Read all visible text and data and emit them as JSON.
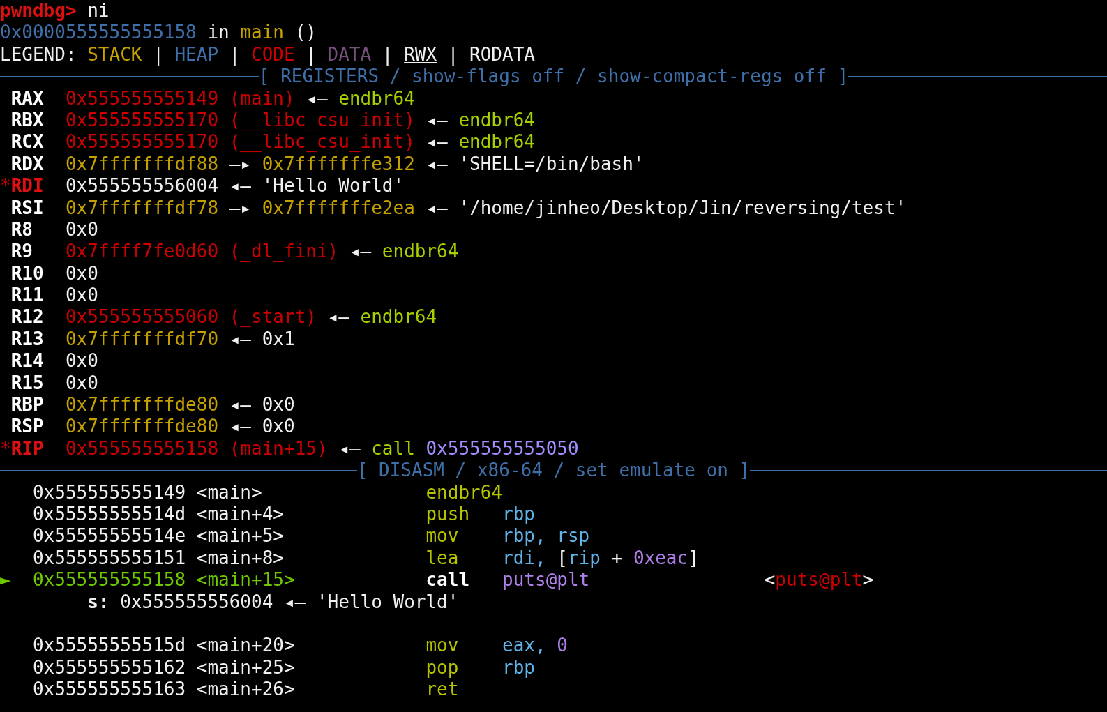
{
  "header_lines": [
    [
      {
        "text": "pwndbg>",
        "kind": "prompt"
      },
      {
        "text": "ni",
        "kind": "plain"
      }
    ],
    [
      {
        "text": "0x0000555555555158",
        "kind": "heap"
      },
      {
        "text": "in",
        "kind": "plain"
      },
      {
        "text": "main",
        "kind": "stack"
      },
      {
        "text": "()",
        "kind": "plain"
      }
    ],
    [
      {
        "text": "LEGEND:",
        "kind": "plain"
      },
      {
        "text": "STACK",
        "kind": "stack"
      },
      {
        "text": "|",
        "kind": "plain"
      },
      {
        "text": "HEAP",
        "kind": "heap"
      },
      {
        "text": "|",
        "kind": "plain"
      },
      {
        "text": "CODE",
        "kind": "code"
      },
      {
        "text": "|",
        "kind": "plain"
      },
      {
        "text": "DATA",
        "kind": "data"
      },
      {
        "text": "|",
        "kind": "plain"
      },
      {
        "text": "RWX",
        "kind": "rwx"
      },
      {
        "text": "|",
        "kind": "plain"
      },
      {
        "text": "RODATA",
        "kind": "plain"
      }
    ]
  ],
  "registers": {
    "title": "[ REGISTERS / show-flags off / show-compact-regs off ]",
    "rows": [
      {
        "name": "RAX",
        "changed": false,
        "values": [
          {
            "text": "0x555555555149 (main)",
            "kind": "code"
          },
          {
            "text": "◂—",
            "kind": "plain"
          },
          {
            "text": "endbr64",
            "kind": "instr"
          }
        ]
      },
      {
        "name": "RBX",
        "changed": false,
        "values": [
          {
            "text": "0x555555555170 (__libc_csu_init)",
            "kind": "code"
          },
          {
            "text": "◂—",
            "kind": "plain"
          },
          {
            "text": "endbr64",
            "kind": "instr"
          }
        ]
      },
      {
        "name": "RCX",
        "changed": false,
        "values": [
          {
            "text": "0x555555555170 (__libc_csu_init)",
            "kind": "code"
          },
          {
            "text": "◂—",
            "kind": "plain"
          },
          {
            "text": "endbr64",
            "kind": "instr"
          }
        ]
      },
      {
        "name": "RDX",
        "changed": false,
        "values": [
          {
            "text": "0x7fffffffdf88",
            "kind": "stack"
          },
          {
            "text": "—▸",
            "kind": "plain"
          },
          {
            "text": "0x7fffffffe312",
            "kind": "stack"
          },
          {
            "text": "◂—",
            "kind": "plain"
          },
          {
            "text": "'SHELL=/bin/bash'",
            "kind": "plain"
          }
        ]
      },
      {
        "marker": "*",
        "name": "RDI",
        "changed": true,
        "values": [
          {
            "text": "0x555555556004",
            "kind": "plain"
          },
          {
            "text": "◂—",
            "kind": "plain"
          },
          {
            "text": "'Hello World'",
            "kind": "plain"
          }
        ]
      },
      {
        "name": "RSI",
        "changed": false,
        "values": [
          {
            "text": "0x7fffffffdf78",
            "kind": "stack"
          },
          {
            "text": "—▸",
            "kind": "plain"
          },
          {
            "text": "0x7fffffffe2ea",
            "kind": "stack"
          },
          {
            "text": "◂—",
            "kind": "plain"
          },
          {
            "text": "'/home/jinheo/Desktop/Jin/reversing/test'",
            "kind": "plain"
          }
        ]
      },
      {
        "name": "R8",
        "changed": false,
        "values": [
          {
            "text": "0x0",
            "kind": "plain"
          }
        ]
      },
      {
        "name": "R9",
        "changed": false,
        "values": [
          {
            "text": "0x7ffff7fe0d60 (_dl_fini)",
            "kind": "code"
          },
          {
            "text": "◂—",
            "kind": "plain"
          },
          {
            "text": "endbr64",
            "kind": "instr"
          }
        ]
      },
      {
        "name": "R10",
        "changed": false,
        "values": [
          {
            "text": "0x0",
            "kind": "plain"
          }
        ]
      },
      {
        "name": "R11",
        "changed": false,
        "values": [
          {
            "text": "0x0",
            "kind": "plain"
          }
        ]
      },
      {
        "name": "R12",
        "changed": false,
        "values": [
          {
            "text": "0x555555555060 (_start)",
            "kind": "code"
          },
          {
            "text": "◂—",
            "kind": "plain"
          },
          {
            "text": "endbr64",
            "kind": "instr"
          }
        ]
      },
      {
        "name": "R13",
        "changed": false,
        "values": [
          {
            "text": "0x7fffffffdf70",
            "kind": "stack"
          },
          {
            "text": "◂—",
            "kind": "plain"
          },
          {
            "text": "0x1",
            "kind": "plain"
          }
        ]
      },
      {
        "name": "R14",
        "changed": false,
        "values": [
          {
            "text": "0x0",
            "kind": "plain"
          }
        ]
      },
      {
        "name": "R15",
        "changed": false,
        "values": [
          {
            "text": "0x0",
            "kind": "plain"
          }
        ]
      },
      {
        "name": "RBP",
        "changed": false,
        "values": [
          {
            "text": "0x7fffffffde80",
            "kind": "stack"
          },
          {
            "text": "◂—",
            "kind": "plain"
          },
          {
            "text": "0x0",
            "kind": "plain"
          }
        ]
      },
      {
        "name": "RSP",
        "changed": false,
        "values": [
          {
            "text": "0x7fffffffde80",
            "kind": "stack"
          },
          {
            "text": "◂—",
            "kind": "plain"
          },
          {
            "text": "0x0",
            "kind": "plain"
          }
        ]
      },
      {
        "marker": "*",
        "name": "RIP",
        "changed": true,
        "values": [
          {
            "text": "0x555555555158 (main+15)",
            "kind": "code"
          },
          {
            "text": "◂—",
            "kind": "plain"
          },
          {
            "text": "call",
            "kind": "instr"
          },
          {
            "text": "0x555555555050",
            "kind": "violet"
          }
        ]
      }
    ]
  },
  "disasm": {
    "title": "[ DISASM / x86-64 / set emulate on ]",
    "rows": [
      {
        "kind": "instruction",
        "current": false,
        "address": "0x555555555149",
        "symbol": "<main>",
        "mnemonic": "endbr64",
        "operands": []
      },
      {
        "kind": "instruction",
        "current": false,
        "address": "0x55555555514d",
        "symbol": "<main+4>",
        "mnemonic": "push",
        "operands": [
          {
            "text": "rbp",
            "kind": "reg"
          }
        ]
      },
      {
        "kind": "instruction",
        "current": false,
        "address": "0x55555555514e",
        "symbol": "<main+5>",
        "mnemonic": "mov",
        "operands": [
          {
            "text": "rbp, rsp",
            "kind": "reg"
          }
        ]
      },
      {
        "kind": "instruction",
        "current": false,
        "address": "0x555555555151",
        "symbol": "<main+8>",
        "mnemonic": "lea",
        "operands": [
          {
            "text": "rdi, ",
            "kind": "reg"
          },
          {
            "text": "[",
            "kind": "plain"
          },
          {
            "text": "rip",
            "kind": "reg"
          },
          {
            "text": " + ",
            "kind": "plain"
          },
          {
            "text": "0xeac",
            "kind": "num"
          },
          {
            "text": "]",
            "kind": "plain"
          }
        ]
      },
      {
        "kind": "instruction",
        "current": true,
        "marker": "►",
        "address": "0x555555555158",
        "symbol": "<main+15>",
        "mnemonic": "call",
        "operands": [
          {
            "text": "puts@plt",
            "kind": "num"
          }
        ],
        "comment": [
          {
            "text": "<",
            "kind": "plain"
          },
          {
            "text": "puts@plt",
            "kind": "code"
          },
          {
            "text": ">",
            "kind": "plain"
          }
        ]
      },
      {
        "kind": "note",
        "values": [
          {
            "text": "s:",
            "kind": "bold"
          },
          {
            "text": "0x555555556004",
            "kind": "plain"
          },
          {
            "text": "◂—",
            "kind": "plain"
          },
          {
            "text": "'Hello World'",
            "kind": "plain"
          }
        ]
      },
      {
        "kind": "blank"
      },
      {
        "kind": "instruction",
        "current": false,
        "address": "0x55555555515d",
        "symbol": "<main+20>",
        "mnemonic": "mov",
        "operands": [
          {
            "text": "eax, ",
            "kind": "reg"
          },
          {
            "text": "0",
            "kind": "num"
          }
        ]
      },
      {
        "kind": "instruction",
        "current": false,
        "address": "0x555555555162",
        "symbol": "<main+25>",
        "mnemonic": "pop",
        "operands": [
          {
            "text": "rbp",
            "kind": "reg"
          }
        ]
      },
      {
        "kind": "instruction",
        "current": false,
        "address": "0x555555555163",
        "symbol": "<main+26>",
        "mnemonic": "ret",
        "operands": []
      }
    ]
  }
}
